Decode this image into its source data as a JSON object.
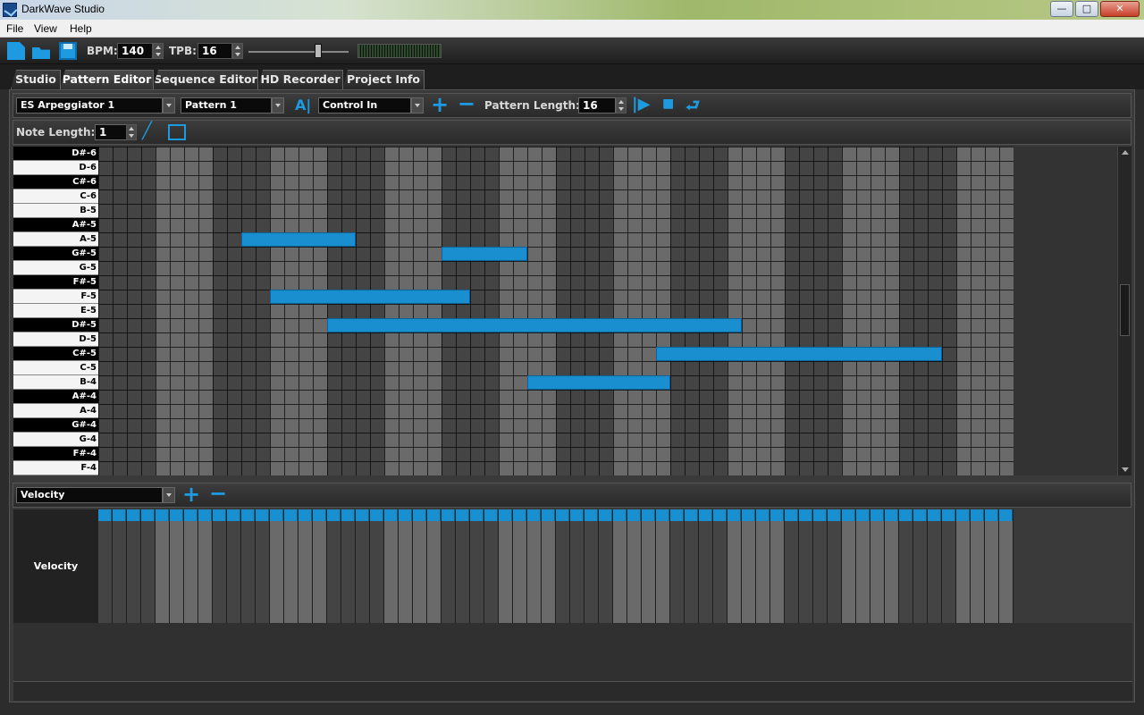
{
  "window": {
    "title": "DarkWave Studio",
    "minimize": "—",
    "maximize": "□",
    "close": "✕"
  },
  "menu": [
    {
      "label": "File"
    },
    {
      "label": "View"
    },
    {
      "label": "Help"
    }
  ],
  "toolbar": {
    "bpm_label": "BPM:",
    "bpm_value": "140",
    "tpb_label": "TPB:",
    "tpb_value": "16",
    "volume_level": 0.78
  },
  "tabs": [
    {
      "label": "Studio",
      "active": false
    },
    {
      "label": "Pattern Editor",
      "active": true
    },
    {
      "label": "Sequence Editor",
      "active": false
    },
    {
      "label": "HD Recorder",
      "active": false
    },
    {
      "label": "Project Info",
      "active": false
    }
  ],
  "pattern_bar": {
    "instrument": "ES Arpeggiator 1",
    "pattern": "Pattern 1",
    "input": "Control In",
    "pattern_length_label": "Pattern Length:",
    "pattern_length_value": "16"
  },
  "note_bar": {
    "note_length_label": "Note Length:",
    "note_length_value": "1"
  },
  "piano_keys": [
    {
      "label": "D#-6",
      "black": true
    },
    {
      "label": "D-6",
      "black": false
    },
    {
      "label": "C#-6",
      "black": true
    },
    {
      "label": "C-6",
      "black": false
    },
    {
      "label": "B-5",
      "black": false
    },
    {
      "label": "A#-5",
      "black": true
    },
    {
      "label": "A-5",
      "black": false
    },
    {
      "label": "G#-5",
      "black": true
    },
    {
      "label": "G-5",
      "black": false
    },
    {
      "label": "F#-5",
      "black": true
    },
    {
      "label": "F-5",
      "black": false
    },
    {
      "label": "E-5",
      "black": false
    },
    {
      "label": "D#-5",
      "black": true
    },
    {
      "label": "D-5",
      "black": false
    },
    {
      "label": "C#-5",
      "black": true
    },
    {
      "label": "C-5",
      "black": false
    },
    {
      "label": "B-4",
      "black": false
    },
    {
      "label": "A#-4",
      "black": true
    },
    {
      "label": "A-4",
      "black": false
    },
    {
      "label": "G#-4",
      "black": true
    },
    {
      "label": "G-4",
      "black": false
    },
    {
      "label": "F#-4",
      "black": true
    },
    {
      "label": "F-4",
      "black": false
    }
  ],
  "notes": [
    {
      "pitch": "A-5",
      "start": 10,
      "length": 8
    },
    {
      "pitch": "G#-5",
      "start": 24,
      "length": 6
    },
    {
      "pitch": "F-5",
      "start": 12,
      "length": 14
    },
    {
      "pitch": "D#-5",
      "start": 16,
      "length": 29
    },
    {
      "pitch": "C#-5",
      "start": 39,
      "length": 20
    },
    {
      "pitch": "B-4",
      "start": 30,
      "length": 10
    }
  ],
  "grid": {
    "steps": 64,
    "beat": 4
  },
  "velocity": {
    "dropdown": "Velocity",
    "label": "Velocity"
  },
  "colors": {
    "note": "#1a8fd0",
    "accent": "#1e9be0"
  }
}
